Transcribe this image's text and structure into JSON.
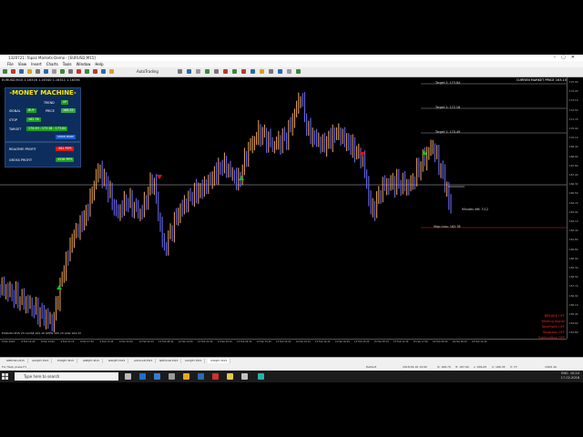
{
  "window": {
    "title": "1320721: Topaz Markets-Demo - [EURUSD,M15]",
    "menu": [
      "File",
      "View",
      "Insert",
      "Charts",
      "Tools",
      "Window",
      "Help"
    ],
    "autotrading_label": "AutoTrading"
  },
  "chart": {
    "header": "EURUSD,M15 1.16316 1.16340 1.16311 1.16336",
    "market_price_label": "CURREN MARKET PRICE 163.15",
    "ohlc_bottom": "EURUSD M15 23 CLOSE 164.18 OPEN 165.70 LOW 164.33",
    "price_axis": [
      "175.00",
      "174.20",
      "173.10",
      "172.50",
      "171.70",
      "170.90",
      "170.10",
      "169.40",
      "168.60",
      "167.80",
      "167.00",
      "166.30",
      "165.50",
      "164.70",
      "163.90",
      "163.10",
      "162.40",
      "161.60",
      "160.80",
      "160.00",
      "159.30",
      "158.50",
      "157.70",
      "156.90",
      "156.10",
      "155.40",
      "154.60",
      "153.80"
    ],
    "time_axis": [
      "8 Feb 2018",
      "8 Feb 12:45",
      "8 Feb 19:00",
      "9 Feb 01:15",
      "9 Feb 07:30",
      "9 Feb 13:45",
      "9 Feb 20:00",
      "12 Feb 02:15",
      "12 Feb 08:30",
      "12 Feb 14:45",
      "12 Feb 21:00",
      "13 Feb 03:15",
      "13 Feb 09:30",
      "13 Feb 15:45",
      "13 Feb 22:00",
      "14 Feb 04:15",
      "14 Feb 10:30",
      "14 Feb 16:45",
      "14 Feb 23:00",
      "15 Feb 05:15",
      "15 Feb 11:30",
      "15 Feb 17:45",
      "16 Feb 00:00",
      "16 Feb 06:15",
      "16 Feb 12:30"
    ],
    "levels": {
      "target2": "Target 2: 173.84",
      "target1b": "Target 2: 172.16",
      "target1": "Target 1: 170.49",
      "minutes": "Minutes left: 3:12",
      "stoploss": "Stop Loss: 162.76"
    },
    "status_lines": [
      "BREAKE OFF",
      "Waiting Signal",
      "TakeProfit OFF",
      "StopLoss OFF",
      "TrailingStop OFF"
    ],
    "colors": {
      "up": "#f0a860",
      "down": "#7070ff",
      "buy": "#16c016",
      "sell": "#e01010"
    }
  },
  "panel": {
    "title": "-MONEY MACHINE-",
    "trend_label": "TREND",
    "trend_value": "UP",
    "signal_label": "SIGNAL",
    "signal_value": "BUY",
    "price_label": "PRICE",
    "price_value": "168.35",
    "stop_label": "STOP",
    "stop_value": "162.76",
    "target_label": "TARGET",
    "target_value": "170.49 - 172.16 - 173.84",
    "button_label": "SHOW MORE",
    "realtime_label": "REALTIME PROFIT",
    "realtime_value": "-561 PIPS",
    "gross_label": "GROSS PROFIT",
    "gross_value": "4536 PIPS"
  },
  "tabs": [
    "GBPUSD,M15",
    "AUDJPY,M15",
    "EURJPY,M15",
    "GBPJPY,M15",
    "NZDJPY,M15",
    "AUDCAD,M15",
    "NZDCAD,M15",
    "AUDJPY,M15",
    "USDJPY,M15"
  ],
  "active_tab": 8,
  "statusbar": {
    "help": "For Help, press F1",
    "profile": "Default",
    "datetime": "2018.02.16 14:00",
    "o": "O: 166.70",
    "h": "H: 167.00",
    "l": "L: 166.05",
    "c": "C: 166.35",
    "v": "V: 73",
    "conn": "196/1 kb"
  },
  "taskbar": {
    "search_placeholder": "Type here to search",
    "time": "10:24",
    "date": "17-02-2018",
    "lang": "ENG"
  }
}
